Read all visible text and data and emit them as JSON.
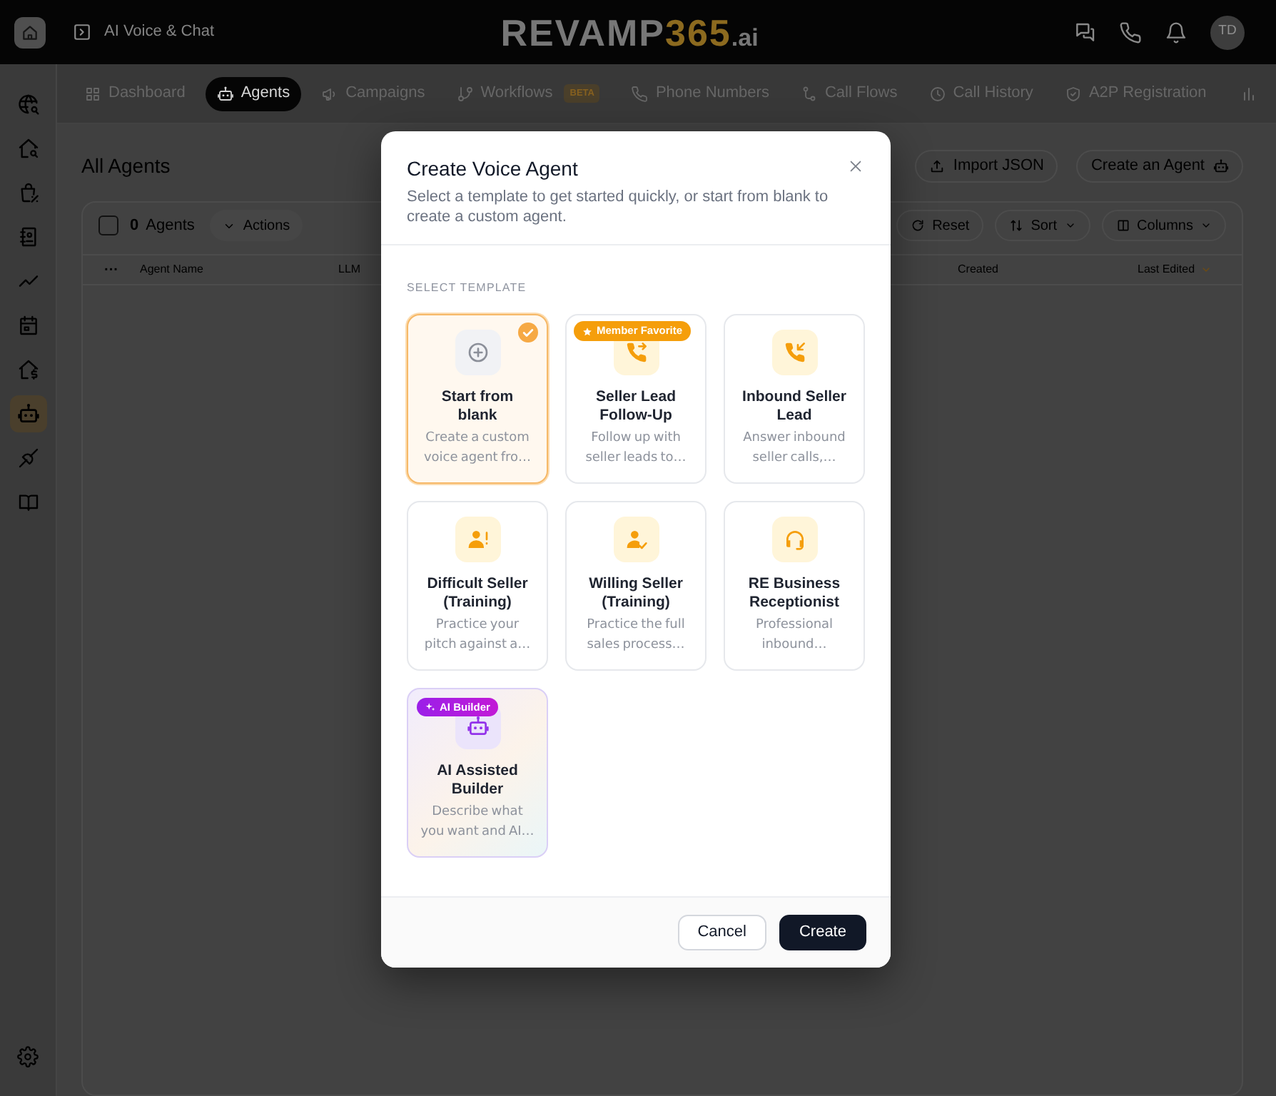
{
  "top_bar": {
    "app_name": "AI Voice & Chat",
    "logo": {
      "text": "REVAMP",
      "accent": "365",
      "suffix": ".ai"
    },
    "avatar": "TD"
  },
  "sidebar": {
    "items": [
      {
        "selected": false
      },
      {
        "selected": false
      },
      {
        "selected": false
      },
      {
        "selected": false
      },
      {
        "selected": false
      },
      {
        "selected": false
      },
      {
        "selected": false
      },
      {
        "selected": true
      },
      {
        "selected": false
      },
      {
        "selected": false
      }
    ]
  },
  "nav_tabs": [
    {
      "label": "Dashboard",
      "selected": false
    },
    {
      "label": "Agents",
      "selected": true
    },
    {
      "label": "Campaigns",
      "selected": false
    },
    {
      "label": "Workflows",
      "selected": false,
      "badge": "BETA"
    },
    {
      "label": "Phone Numbers",
      "selected": false
    },
    {
      "label": "Call Flows",
      "selected": false
    },
    {
      "label": "Call History",
      "selected": false
    },
    {
      "label": "A2P Registration",
      "selected": false
    }
  ],
  "page": {
    "title": "All Agents",
    "buttons": [
      "Import JSON",
      "Create an Agent"
    ]
  },
  "toolbar": {
    "select_all_checked": false,
    "count": "0",
    "count_label": "Agents",
    "bulk_action": "Actions",
    "buttons": [
      {
        "label": "Reset",
        "dropdown": false
      },
      {
        "label": "Sort",
        "dropdown": true
      },
      {
        "label": "Columns",
        "dropdown": true
      }
    ]
  },
  "table": {
    "columns": [
      {
        "label": "···",
        "sorted": false
      },
      {
        "label": "Agent Name",
        "sorted": false
      },
      {
        "label": "LLM",
        "sorted": false
      },
      {
        "label": "Created",
        "sorted": false
      },
      {
        "label": "Last Edited",
        "sorted": true
      }
    ]
  },
  "dialog": {
    "title": "Create Voice Agent",
    "subtitle": "Select a template to get started quickly, or start from blank to create a custom agent.",
    "section_label": "SELECT TEMPLATE",
    "templates": [
      {
        "kind": "blank",
        "title": "Start from blank",
        "description": "Create a custom voice agent fro…",
        "selected": true
      },
      {
        "kind": "template",
        "title": "Seller Lead Follow-Up",
        "description": "Follow up with seller leads to…",
        "selected": false,
        "badge": {
          "kind": "favorite",
          "text": "Member Favorite"
        }
      },
      {
        "kind": "template",
        "title": "Inbound Seller Lead",
        "description": "Answer inbound seller calls,…",
        "selected": false
      },
      {
        "kind": "template",
        "title": "Difficult Seller (Training)",
        "description": "Practice your pitch against a…",
        "selected": false
      },
      {
        "kind": "template",
        "title": "Willing Seller (Training)",
        "description": "Practice the full sales process…",
        "selected": false
      },
      {
        "kind": "template",
        "title": "RE Business Receptionist",
        "description": "Professional inbound…",
        "selected": false
      },
      {
        "kind": "ai",
        "title": "AI Assisted Builder",
        "description": "Describe what you want and AI…",
        "selected": false,
        "badge": {
          "kind": "ai",
          "text": "AI Builder"
        }
      }
    ],
    "buttons": [
      {
        "label": "Cancel",
        "kind": "secondary"
      },
      {
        "label": "Create",
        "kind": "primary"
      }
    ]
  }
}
